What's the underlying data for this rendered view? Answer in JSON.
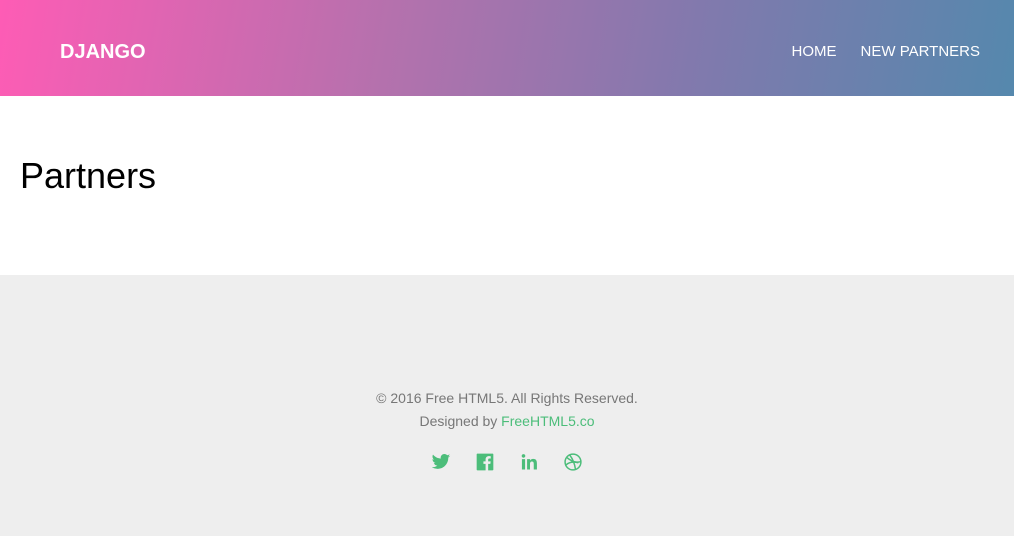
{
  "header": {
    "logo": "DJANGO",
    "nav": [
      {
        "label": "HOME"
      },
      {
        "label": "NEW PARTNERS"
      }
    ]
  },
  "main": {
    "title": "Partners"
  },
  "footer": {
    "copyright": "© 2016 Free HTML5. All Rights Reserved.",
    "designed_prefix": "Designed by",
    "designed_link": "FreeHTML5.co",
    "social": [
      {
        "icon": "twitter-icon"
      },
      {
        "icon": "facebook-icon"
      },
      {
        "icon": "linkedin-icon"
      },
      {
        "icon": "dribbble-icon"
      }
    ]
  },
  "colors": {
    "accent": "#4cbd7a",
    "gradient_start": "#fe5cb5",
    "gradient_end": "#5588ad",
    "footer_bg": "#eeeeee"
  }
}
